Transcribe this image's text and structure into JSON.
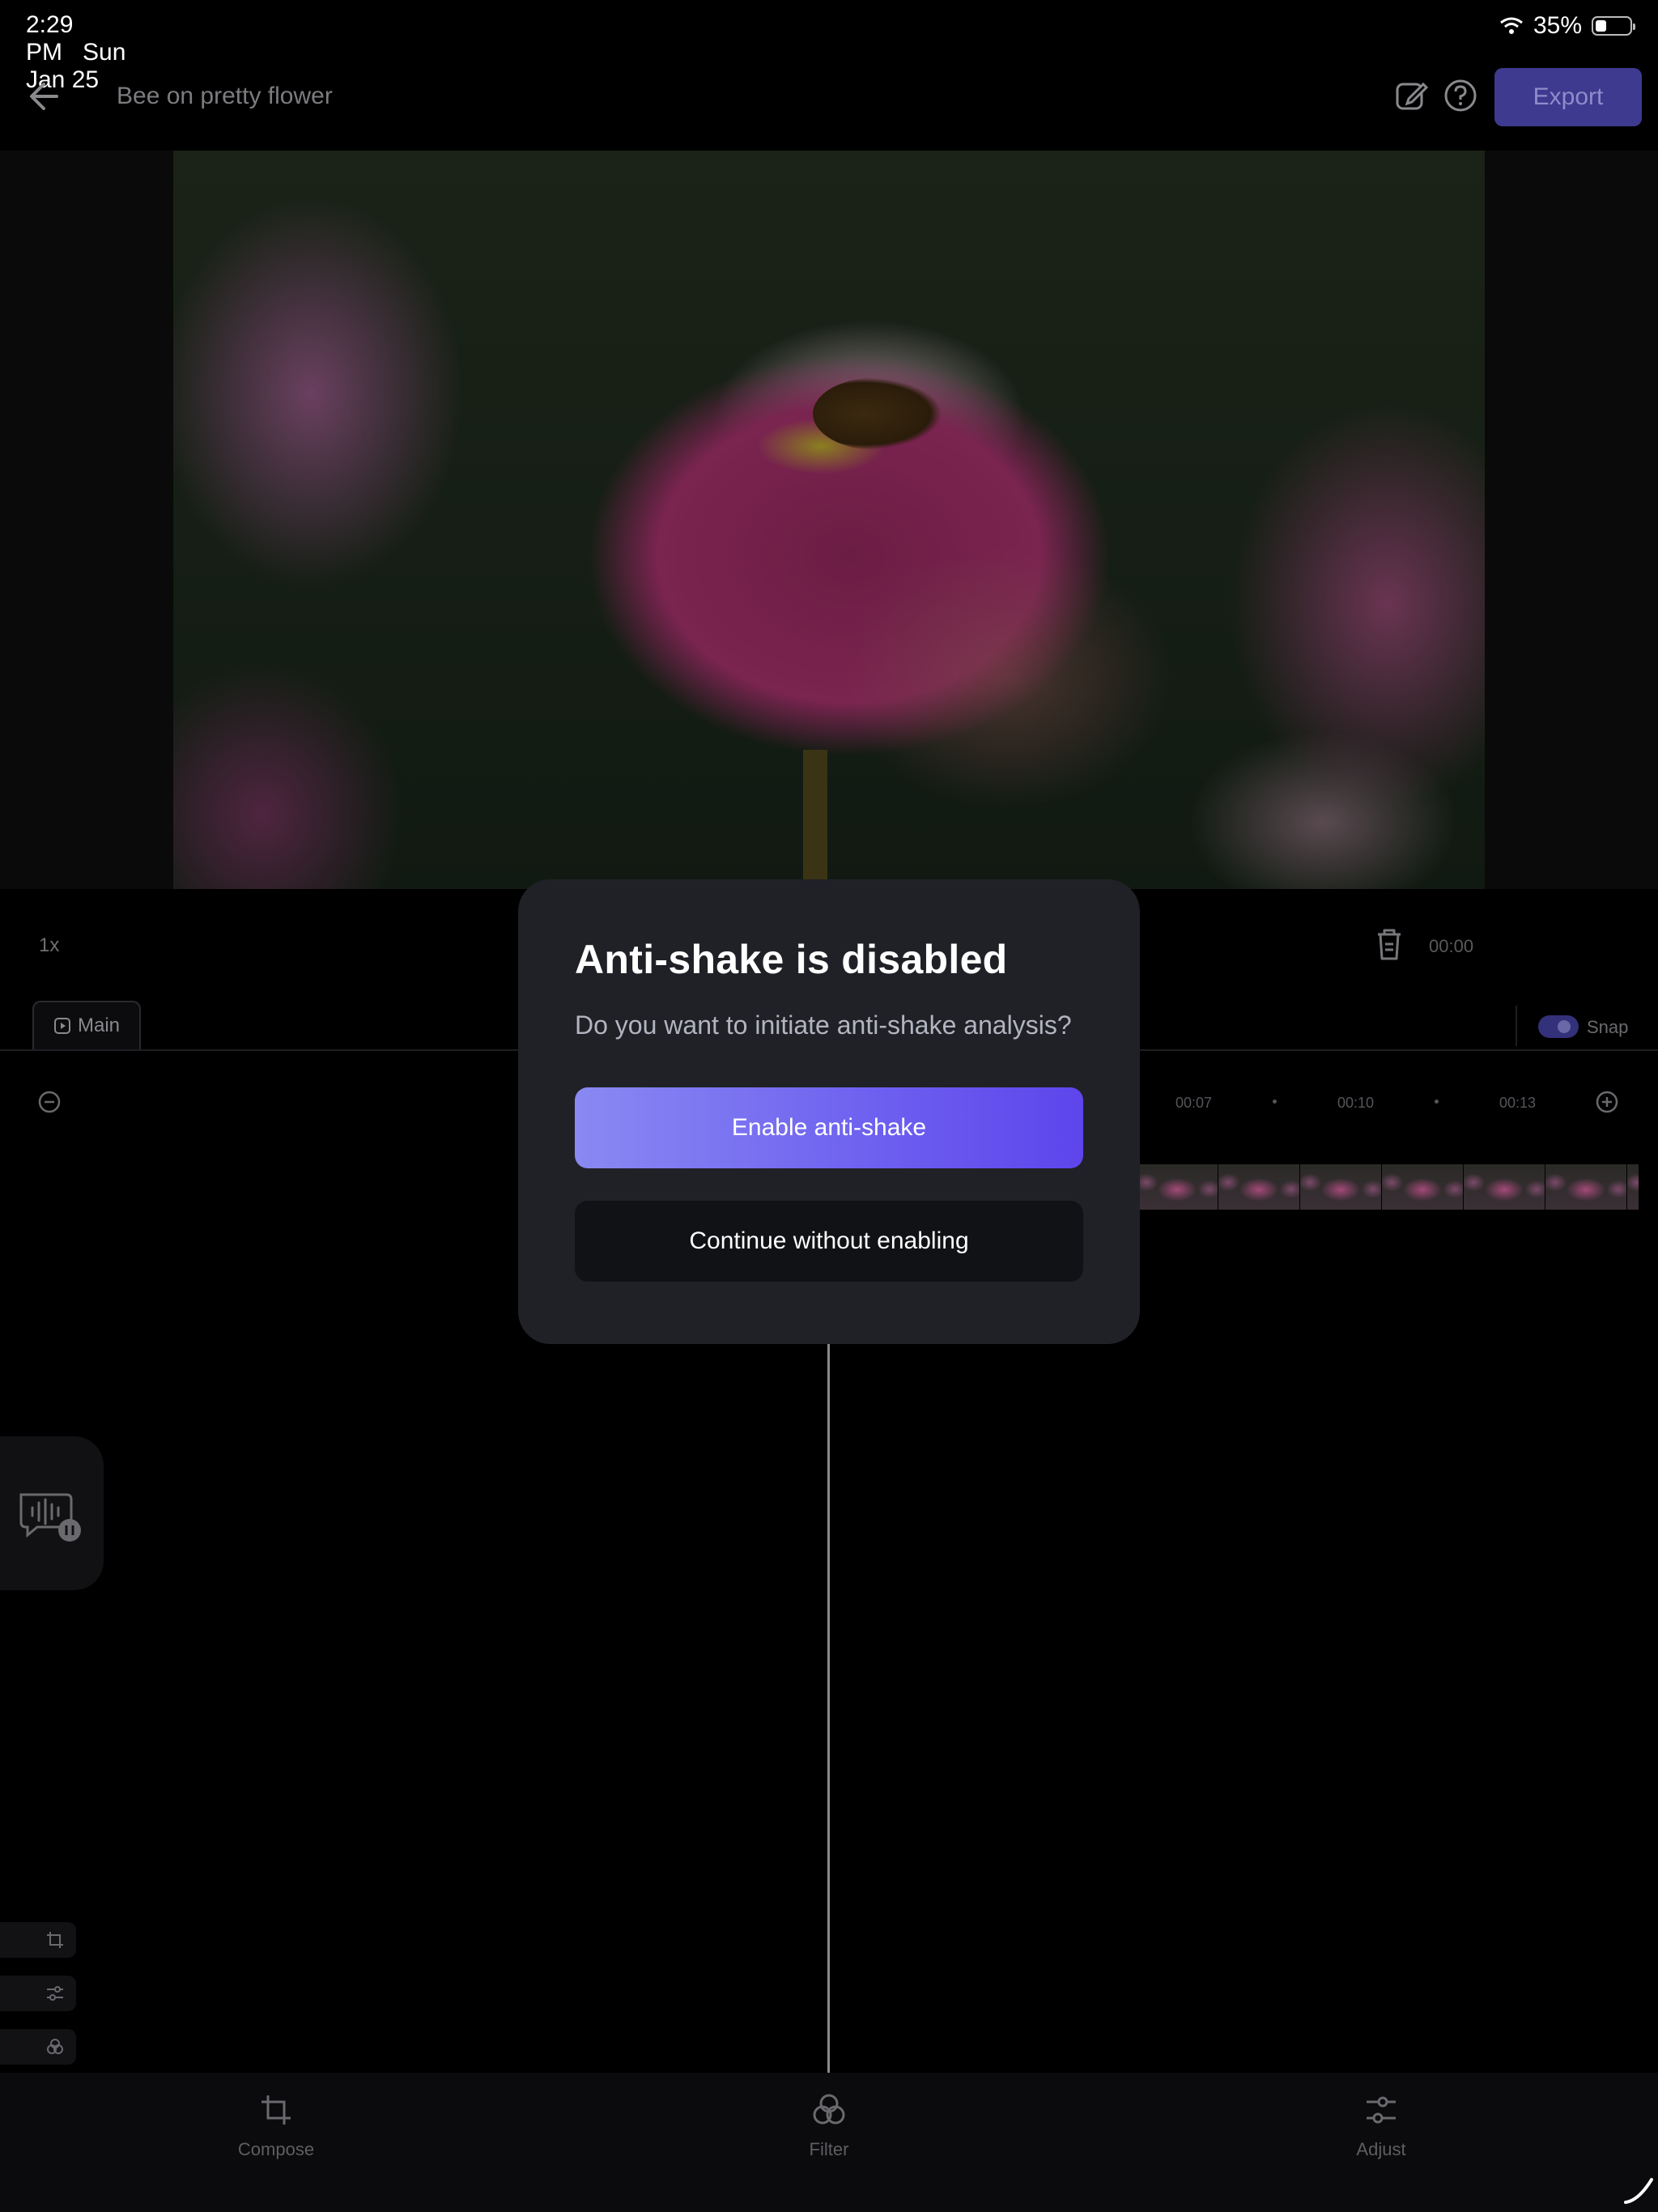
{
  "status_bar": {
    "time": "2:29 PM",
    "date": "Sun Jan 25",
    "battery": "35%"
  },
  "header": {
    "title": "Bee on pretty flower",
    "export_label": "Export"
  },
  "controls": {
    "speed": "1x",
    "time_readout": "00:00"
  },
  "tabs": {
    "main_label": "Main",
    "snap_label": "Snap"
  },
  "timeline": {
    "ticks": [
      "00:07",
      "00:10",
      "00:13"
    ]
  },
  "bottom_bar": {
    "compose": "Compose",
    "filter": "Filter",
    "adjust": "Adjust"
  },
  "dialog": {
    "title": "Anti-shake is disabled",
    "message": "Do you want to initiate anti-shake analysis?",
    "primary_label": "Enable anti-shake",
    "secondary_label": "Continue without enabling"
  },
  "colors": {
    "accent": "#6f63f0",
    "export_bg": "#3d3a8f",
    "dialog_bg": "#202126"
  }
}
